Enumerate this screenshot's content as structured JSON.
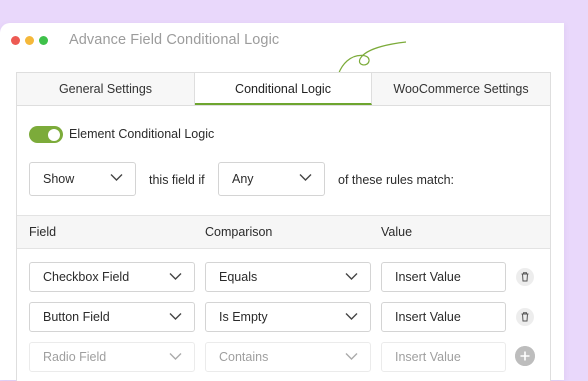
{
  "window": {
    "title": "Advance Field Conditional Logic"
  },
  "tabs": [
    {
      "label": "General Settings",
      "active": false
    },
    {
      "label": "Conditional Logic",
      "active": true
    },
    {
      "label": "WooCommerce Settings",
      "active": false
    }
  ],
  "toggle": {
    "label": "Element Conditional Logic",
    "on": true
  },
  "rule_sentence": {
    "action_value": "Show",
    "middle_text": "this field if",
    "match_value": "Any",
    "end_text": "of these rules match:"
  },
  "table": {
    "headers": [
      "Field",
      "Comparison",
      "Value"
    ],
    "rows": [
      {
        "field": "Checkbox Field",
        "comparison": "Equals",
        "value": "Insert Value"
      },
      {
        "field": "Button Field",
        "comparison": "Is Empty",
        "value": "Insert Value"
      },
      {
        "field": "Radio Field",
        "comparison": "Contains",
        "value": "Insert Value"
      }
    ]
  },
  "colors": {
    "accent": "#6ea52f",
    "background": "#e9d8fb"
  }
}
